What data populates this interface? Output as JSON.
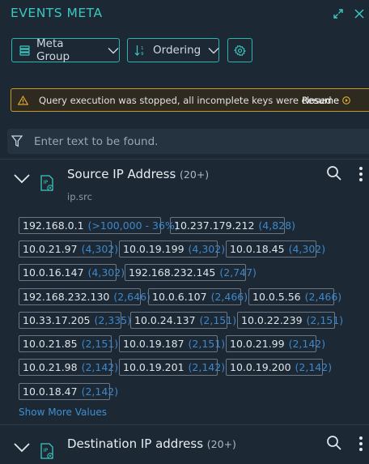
{
  "header": {
    "title": "EVENTS META"
  },
  "toolbar": {
    "meta_group_label": "Meta Group",
    "ordering_label": "Ordering"
  },
  "warning": {
    "message": "Query execution was stopped, all incomplete keys were closed",
    "resume_label": "Resume"
  },
  "filter": {
    "placeholder": "Enter text to be found."
  },
  "sections": [
    {
      "title": "Source IP Address",
      "count": "(20+)",
      "key": "ip.src",
      "icon_label": "IP",
      "show_more_label": "Show More Values",
      "values": [
        {
          "value": "192.168.0.1",
          "count": "(>100,000 - 36%)"
        },
        {
          "value": "10.237.179.212",
          "count": "(4,828)"
        },
        {
          "value": "10.0.21.97",
          "count": "(4,302)"
        },
        {
          "value": "10.0.19.199",
          "count": "(4,302)"
        },
        {
          "value": "10.0.18.45",
          "count": "(4,302)"
        },
        {
          "value": "10.0.16.147",
          "count": "(4,302)"
        },
        {
          "value": "192.168.232.145",
          "count": "(2,747)"
        },
        {
          "value": "192.168.232.130",
          "count": "(2,646)"
        },
        {
          "value": "10.0.6.107",
          "count": "(2,466)"
        },
        {
          "value": "10.0.5.56",
          "count": "(2,466)"
        },
        {
          "value": "10.33.17.205",
          "count": "(2,335)"
        },
        {
          "value": "10.0.24.137",
          "count": "(2,151)"
        },
        {
          "value": "10.0.22.239",
          "count": "(2,151)"
        },
        {
          "value": "10.0.21.85",
          "count": "(2,151)"
        },
        {
          "value": "10.0.19.187",
          "count": "(2,151)"
        },
        {
          "value": "10.0.21.99",
          "count": "(2,142)"
        },
        {
          "value": "10.0.21.98",
          "count": "(2,142)"
        },
        {
          "value": "10.0.19.201",
          "count": "(2,142)"
        },
        {
          "value": "10.0.19.200",
          "count": "(2,142)"
        },
        {
          "value": "10.0.18.47",
          "count": "(2,142)"
        }
      ]
    },
    {
      "title": "Destination IP address",
      "count": "(20+)",
      "icon_label": "IP"
    }
  ],
  "colors": {
    "accent": "#3cc7c0",
    "background": "#1c2935",
    "warning_border": "#c79a23",
    "count_blue": "#3f87c9"
  },
  "icons": [
    "expand-icon",
    "close-icon",
    "list-icon",
    "sort-icon",
    "gear-icon",
    "warning-icon",
    "play-circle-icon",
    "filter-icon",
    "chevron-down-icon",
    "ip-icon",
    "search-icon",
    "more-vertical-icon"
  ]
}
